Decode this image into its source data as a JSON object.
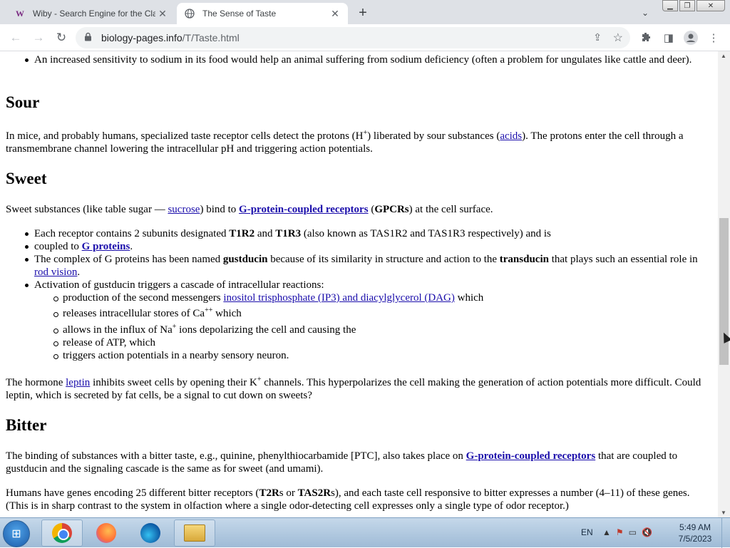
{
  "tabs": [
    {
      "label": "Wiby - Search Engine for the Cla",
      "favicon": "W",
      "close": "✕"
    },
    {
      "label": "The Sense of Taste",
      "favicon": "globe-icon",
      "close": "✕"
    }
  ],
  "new_tab": "+",
  "tab_search": "⌄",
  "window_controls": {
    "minimize": "▁",
    "maximize": "❐",
    "close": "✕"
  },
  "toolbar": {
    "back": "←",
    "forward": "→",
    "reload": "↻",
    "url_host": "biology-pages.info",
    "url_path": "/T/Taste.html",
    "share": "⇪",
    "star": "☆",
    "extensions": "✚",
    "sidepanel": "◨",
    "profile": "●",
    "menu": "⋮"
  },
  "content": {
    "intro_bullet": "An increased sensitivity to sodium in its food would help an animal suffering from sodium deficiency (often a problem for ungulates like cattle and deer).",
    "sour": {
      "heading": "Sour",
      "p1_a": "In mice, and probably humans, specialized taste receptor cells detect the protons (H",
      "p1_sup": "+",
      "p1_b": ") liberated by sour substances (",
      "p1_link": "acids",
      "p1_c": "). The protons enter the cell through a transmembrane channel lowering the intracellular pH and triggering action potentials."
    },
    "sweet": {
      "heading": "Sweet",
      "p1_a": "Sweet substances (like table sugar — ",
      "p1_link1": "sucrose",
      "p1_b": ") bind to ",
      "p1_link2": "G-protein-coupled receptors",
      "p1_c": " (",
      "p1_bold": "GPCRs",
      "p1_d": ") at the cell surface.",
      "b1_a": "Each receptor contains 2 subunits designated ",
      "b1_bold1": "T1R2",
      "b1_b": " and ",
      "b1_bold2": "T1R3",
      "b1_c": " (also known as TAS1R2 and TAS1R3 respectively) and is",
      "b2_a": "coupled to ",
      "b2_link": "G proteins",
      "b2_b": ".",
      "b3_a": "The complex of G proteins has been named ",
      "b3_bold1": "gustducin",
      "b3_b": " because of its similarity in structure and action to the ",
      "b3_bold2": "transducin",
      "b3_c": " that plays such an essential role in ",
      "b3_link": "rod vision",
      "b3_d": ".",
      "b4": "Activation of gustducin triggers a cascade of intracellular reactions:",
      "s1_a": "production of the second messengers ",
      "s1_link": "inositol trisphosphate (IP3) and diacylglycerol (DAG)",
      "s1_b": " which",
      "s2_a": "releases intracellular stores of Ca",
      "s2_sup": "++",
      "s2_b": " which",
      "s3_a": "allows in the influx of Na",
      "s3_sup": "+",
      "s3_b": " ions depolarizing the cell and causing the",
      "s4": "release of ATP, which",
      "s5": "triggers action potentials in a nearby sensory neuron.",
      "p2_a": "The hormone ",
      "p2_link": "leptin",
      "p2_b": " inhibits sweet cells by opening their K",
      "p2_sup": "+",
      "p2_c": " channels. This hyperpolarizes the cell making the generation of action potentials more difficult. Could leptin, which is secreted by fat cells, be a signal to cut down on sweets?"
    },
    "bitter": {
      "heading": "Bitter",
      "p1_a": "The binding of substances with a bitter taste, e.g., quinine, phenylthiocarbamide [PTC], also takes place on ",
      "p1_link": "G-protein-coupled receptors",
      "p1_b": " that are coupled to gustducin and the signaling cascade is the same as for sweet (and umami).",
      "p2_a": "Humans have genes encoding 25 different bitter receptors (",
      "p2_bold1": "T2R",
      "p2_b": "s or ",
      "p2_bold2": "TAS2R",
      "p2_c": "s), and each taste cell responsive to bitter expresses a number (4–11) of these genes. (This is in sharp contrast to the system in olfaction where a single odor-detecting cell expresses only a single type of odor receptor.)"
    }
  },
  "scrollbar": {
    "up": "▲",
    "down": "▼",
    "position_fraction": 0.36
  },
  "taskbar": {
    "start": "⊞",
    "apps": [
      "chrome-icon",
      "firefox-icon",
      "edge-icon",
      "explorer-icon"
    ],
    "language": "EN",
    "tray": [
      "▲",
      "⚑",
      "▭",
      "🔇"
    ],
    "time": "5:49 AM",
    "date": "7/5/2023"
  },
  "colors": {
    "link": "#1a0dab",
    "tabstrip": "#dee1e6",
    "taskbar": "#b5cce3"
  }
}
